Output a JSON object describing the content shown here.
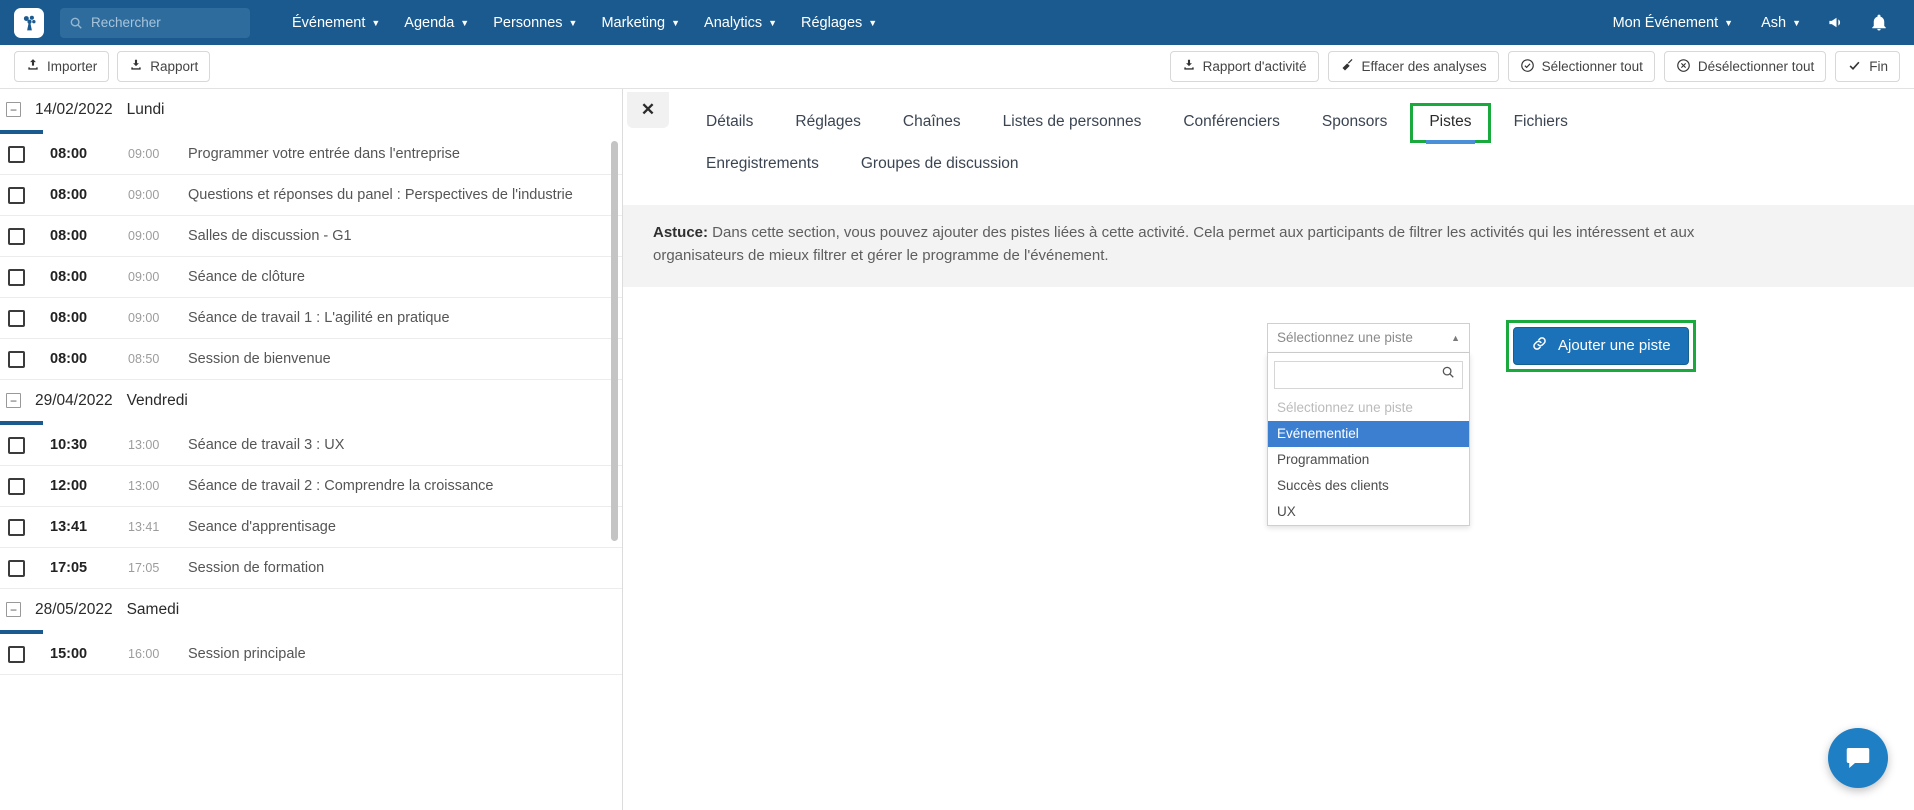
{
  "topnav": {
    "logo_icon": "app-logo-icon",
    "search": {
      "placeholder": "Rechercher",
      "value": "",
      "icon": "search-icon"
    },
    "menus": [
      {
        "label": "Événement"
      },
      {
        "label": "Agenda"
      },
      {
        "label": "Personnes"
      },
      {
        "label": "Marketing"
      },
      {
        "label": "Analytics"
      },
      {
        "label": "Réglages"
      }
    ],
    "right": {
      "event_selector": "Mon Événement",
      "user": "Ash",
      "megaphone_icon": "megaphone-icon",
      "bell_icon": "bell-icon"
    },
    "bg_color": "#1B5A8E"
  },
  "toolbar": {
    "left_buttons": [
      {
        "label": "Importer",
        "icon": "upload-icon"
      },
      {
        "label": "Rapport",
        "icon": "download-icon"
      }
    ],
    "right_buttons": [
      {
        "label": "Rapport d'activité",
        "icon": "download-icon"
      },
      {
        "label": "Effacer des analyses",
        "icon": "broom-icon"
      },
      {
        "label": "Sélectionner tout",
        "icon": "check-circle-icon"
      },
      {
        "label": "Désélectionner tout",
        "icon": "x-circle-icon"
      },
      {
        "label": "Fin",
        "icon": "check-icon"
      }
    ]
  },
  "agenda": {
    "days": [
      {
        "date": "14/02/2022",
        "weekday": "Lundi",
        "activities": [
          {
            "start": "08:00",
            "end": "09:00",
            "title": "Programmer votre entrée dans l'entreprise"
          },
          {
            "start": "08:00",
            "end": "09:00",
            "title": "Questions et réponses du panel : Perspectives de l'industrie"
          },
          {
            "start": "08:00",
            "end": "09:00",
            "title": "Salles de discussion - G1"
          },
          {
            "start": "08:00",
            "end": "09:00",
            "title": "Séance de clôture"
          },
          {
            "start": "08:00",
            "end": "09:00",
            "title": "Séance de travail 1 : L'agilité en pratique"
          },
          {
            "start": "08:00",
            "end": "08:50",
            "title": "Session de bienvenue"
          }
        ]
      },
      {
        "date": "29/04/2022",
        "weekday": "Vendredi",
        "activities": [
          {
            "start": "10:30",
            "end": "13:00",
            "title": "Séance de travail 3 : UX"
          },
          {
            "start": "12:00",
            "end": "13:00",
            "title": "Séance de travail 2 : Comprendre la croissance"
          },
          {
            "start": "13:41",
            "end": "13:41",
            "title": "Seance d'apprentisage"
          },
          {
            "start": "17:05",
            "end": "17:05",
            "title": "Session de formation"
          }
        ]
      },
      {
        "date": "28/05/2022",
        "weekday": "Samedi",
        "activities": [
          {
            "start": "15:00",
            "end": "16:00",
            "title": "Session principale"
          }
        ]
      }
    ]
  },
  "detail_panel": {
    "close_label": "✕",
    "tabs": [
      {
        "label": "Détails",
        "active": false,
        "highlighted": false
      },
      {
        "label": "Réglages",
        "active": false,
        "highlighted": false
      },
      {
        "label": "Chaînes",
        "active": false,
        "highlighted": false
      },
      {
        "label": "Listes de personnes",
        "active": false,
        "highlighted": false
      },
      {
        "label": "Conférenciers",
        "active": false,
        "highlighted": false
      },
      {
        "label": "Sponsors",
        "active": false,
        "highlighted": false
      },
      {
        "label": "Pistes",
        "active": true,
        "highlighted": true
      },
      {
        "label": "Fichiers",
        "active": false,
        "highlighted": false
      },
      {
        "label": "Enregistrements",
        "active": false,
        "highlighted": false
      },
      {
        "label": "Groupes de discussion",
        "active": false,
        "highlighted": false
      }
    ],
    "hint": {
      "prefix": "Astuce:",
      "text": " Dans cette section, vous pouvez ajouter des pistes liées à cette activité. Cela permet aux participants de filtrer les activités qui les intéressent et aux organisateurs de mieux filtrer et gérer le programme de l'événement."
    },
    "track_select": {
      "selected_label": "Sélectionnez une piste",
      "arrow_icon": "chevron-up-icon",
      "search_value": "",
      "search_icon": "search-icon",
      "options": [
        {
          "label": "Sélectionnez une piste",
          "placeholder": true,
          "selected": false
        },
        {
          "label": "Evénementiel",
          "placeholder": false,
          "selected": true
        },
        {
          "label": "Programmation",
          "placeholder": false,
          "selected": false
        },
        {
          "label": "Succès des clients",
          "placeholder": false,
          "selected": false
        },
        {
          "label": "UX",
          "placeholder": false,
          "selected": false
        }
      ]
    },
    "add_button": {
      "label": "Ajouter une piste",
      "icon": "link-icon"
    }
  },
  "chat_widget": {
    "icon": "chat-icon"
  },
  "colors": {
    "nav_blue": "#1B5A8E",
    "highlight_green": "#1aa93c",
    "active_tab_blue": "#4a90d9",
    "primary_button": "#1b72b8",
    "option_selected": "#3c7fd1"
  }
}
